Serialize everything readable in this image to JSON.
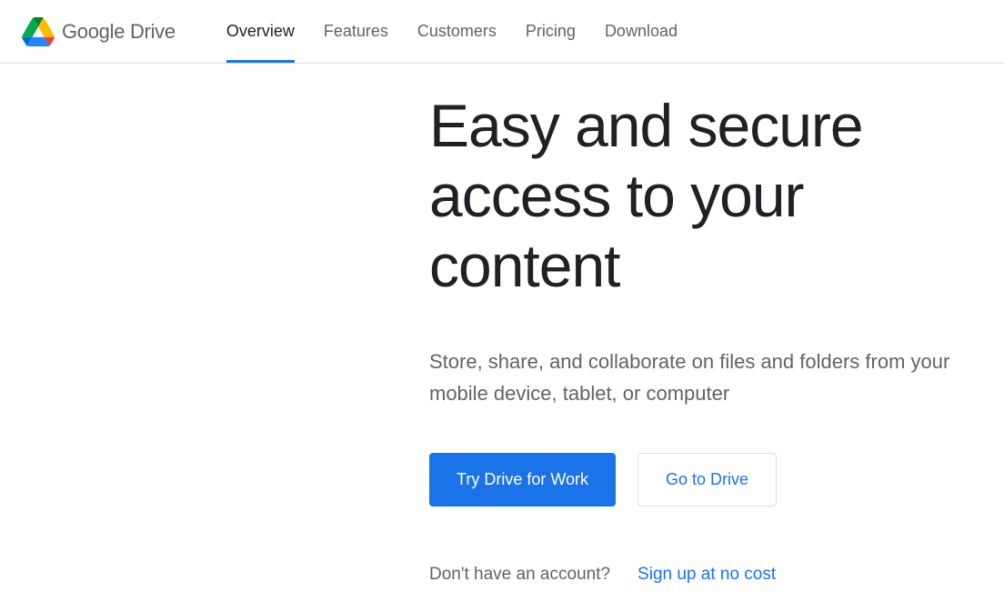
{
  "header": {
    "logo_google": "Google",
    "logo_drive": " Drive"
  },
  "nav": {
    "items": [
      {
        "label": "Overview"
      },
      {
        "label": "Features"
      },
      {
        "label": "Customers"
      },
      {
        "label": "Pricing"
      },
      {
        "label": "Download"
      }
    ]
  },
  "hero": {
    "title": "Easy and secure access to your content",
    "subtitle": "Store, share, and collaborate on files and folders from your mobile device, tablet, or computer",
    "primary_cta": "Try Drive for Work",
    "secondary_cta": "Go to Drive"
  },
  "signup": {
    "prompt": "Don't have an account?",
    "link": "Sign up at no cost"
  }
}
